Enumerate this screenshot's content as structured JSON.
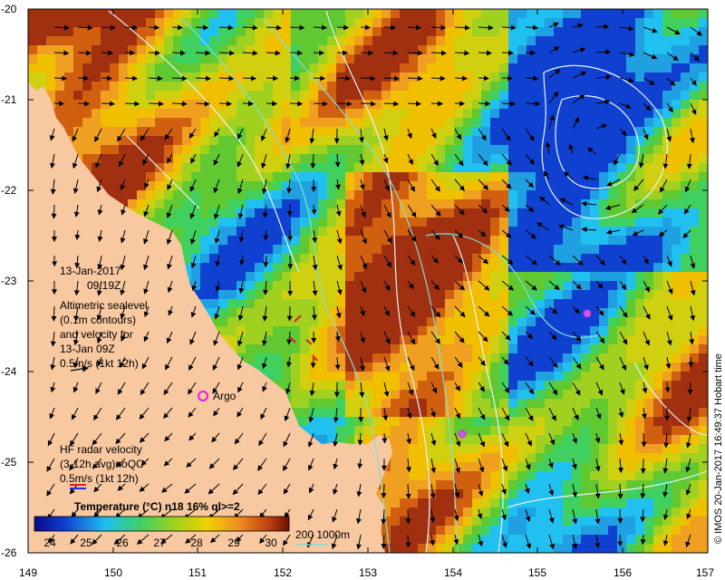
{
  "map": {
    "lon_labels": [
      "149",
      "150",
      "151",
      "152",
      "153",
      "154",
      "155",
      "156",
      "157"
    ],
    "lat_labels": [
      "-20",
      "-21",
      "-22",
      "-23",
      "-24",
      "-25",
      "-26"
    ],
    "date_line1": "13-Jan-2017",
    "date_line2": "09:19Z",
    "altimetry_lines": [
      "Altimetric sealevel",
      "(0.1m contours)",
      "and velocity for",
      "13-Jan 09Z",
      "0.5m/s (1kt 12h)"
    ],
    "argo_label": "Argo",
    "hf_lines": [
      "HF radar velocity",
      "(3-12h avg)noQC",
      "0.5m/s (1kt 12h)"
    ],
    "colorbar_title": "Temperature (°C) n18 16% ql>=2",
    "colorbar_ticks": [
      "24",
      "25",
      "26",
      "27",
      "28",
      "29",
      "30"
    ],
    "depth_label": "200  1000m",
    "credit": "© IMOS 20-Jan-2017 16:49:37 Hobart time",
    "colors": {
      "land": "#f8c8a0",
      "contour": "#e8f4ff",
      "isobath": "#7fe0d8",
      "argo": "#e020e0",
      "hf_red": "#e02020",
      "hf_blue": "#2030e0"
    }
  }
}
